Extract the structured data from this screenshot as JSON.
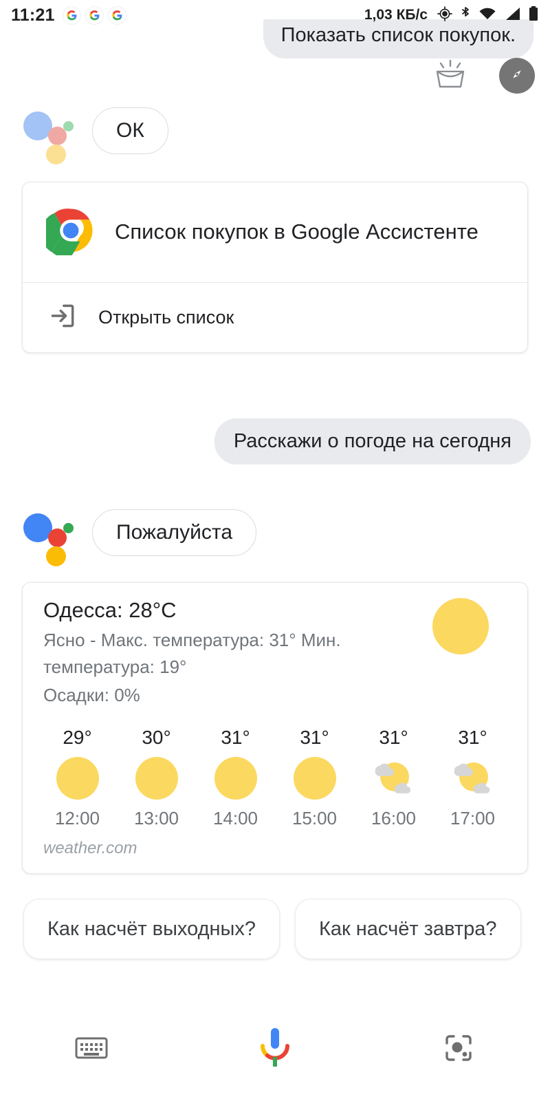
{
  "statusbar": {
    "time": "11:21",
    "notification_icons": [
      "google-icon",
      "google-icon",
      "google-icon"
    ],
    "data_rate": "1,03 КБ/с",
    "icons": [
      "location-icon",
      "bluetooth-icon",
      "wifi-icon",
      "cellular-signal-icon",
      "battery-icon"
    ]
  },
  "conversation": {
    "messages": [
      {
        "role": "user",
        "text": "Показать список покупок."
      },
      {
        "role": "assistant",
        "text": "ОК"
      }
    ],
    "shopping_card": {
      "app_icon": "chrome-icon",
      "title": "Список покупок в Google Ассистенте",
      "action_icon": "open-in-icon",
      "action_label": "Открыть список"
    },
    "weather_query": "Расскажи о погоде на сегодня",
    "weather_reply": "Пожалуйста"
  },
  "weather": {
    "location_temp": "Одесса: 28°C",
    "summary": "Ясно - Макс. температура: 31° Мин. температура: 19°",
    "precipitation": "Осадки: 0%",
    "condition_icon": "sun-icon",
    "source": "weather.com",
    "hourly": [
      {
        "temp": "29°",
        "icon": "sun-icon",
        "time": "12:00"
      },
      {
        "temp": "30°",
        "icon": "sun-icon",
        "time": "13:00"
      },
      {
        "temp": "31°",
        "icon": "sun-icon",
        "time": "14:00"
      },
      {
        "temp": "31°",
        "icon": "sun-icon",
        "time": "15:00"
      },
      {
        "temp": "31°",
        "icon": "partly-cloudy-icon",
        "time": "16:00"
      },
      {
        "temp": "31°",
        "icon": "partly-cloudy-icon",
        "time": "17:00"
      }
    ]
  },
  "suggestions": [
    {
      "label": "Как насчёт выходных?"
    },
    {
      "label": "Как насчёт завтра?"
    }
  ],
  "bottom_bar": {
    "keyboard_icon": "keyboard-icon",
    "mic_icon": "google-mic-icon",
    "lens_icon": "google-lens-icon"
  },
  "overlay": {
    "basket_icon": "shopping-basket-icon",
    "explore_icon": "compass-explore-icon"
  },
  "colors": {
    "google_blue": "#4285f4",
    "google_red": "#ea4335",
    "google_yellow": "#fbbc05",
    "google_green": "#34a853",
    "bubble_gray": "#e8eaed",
    "sun_yellow": "#fbd85f",
    "cloud_gray": "#d6d6d6",
    "text_primary": "#202124",
    "text_secondary": "#70757a"
  }
}
